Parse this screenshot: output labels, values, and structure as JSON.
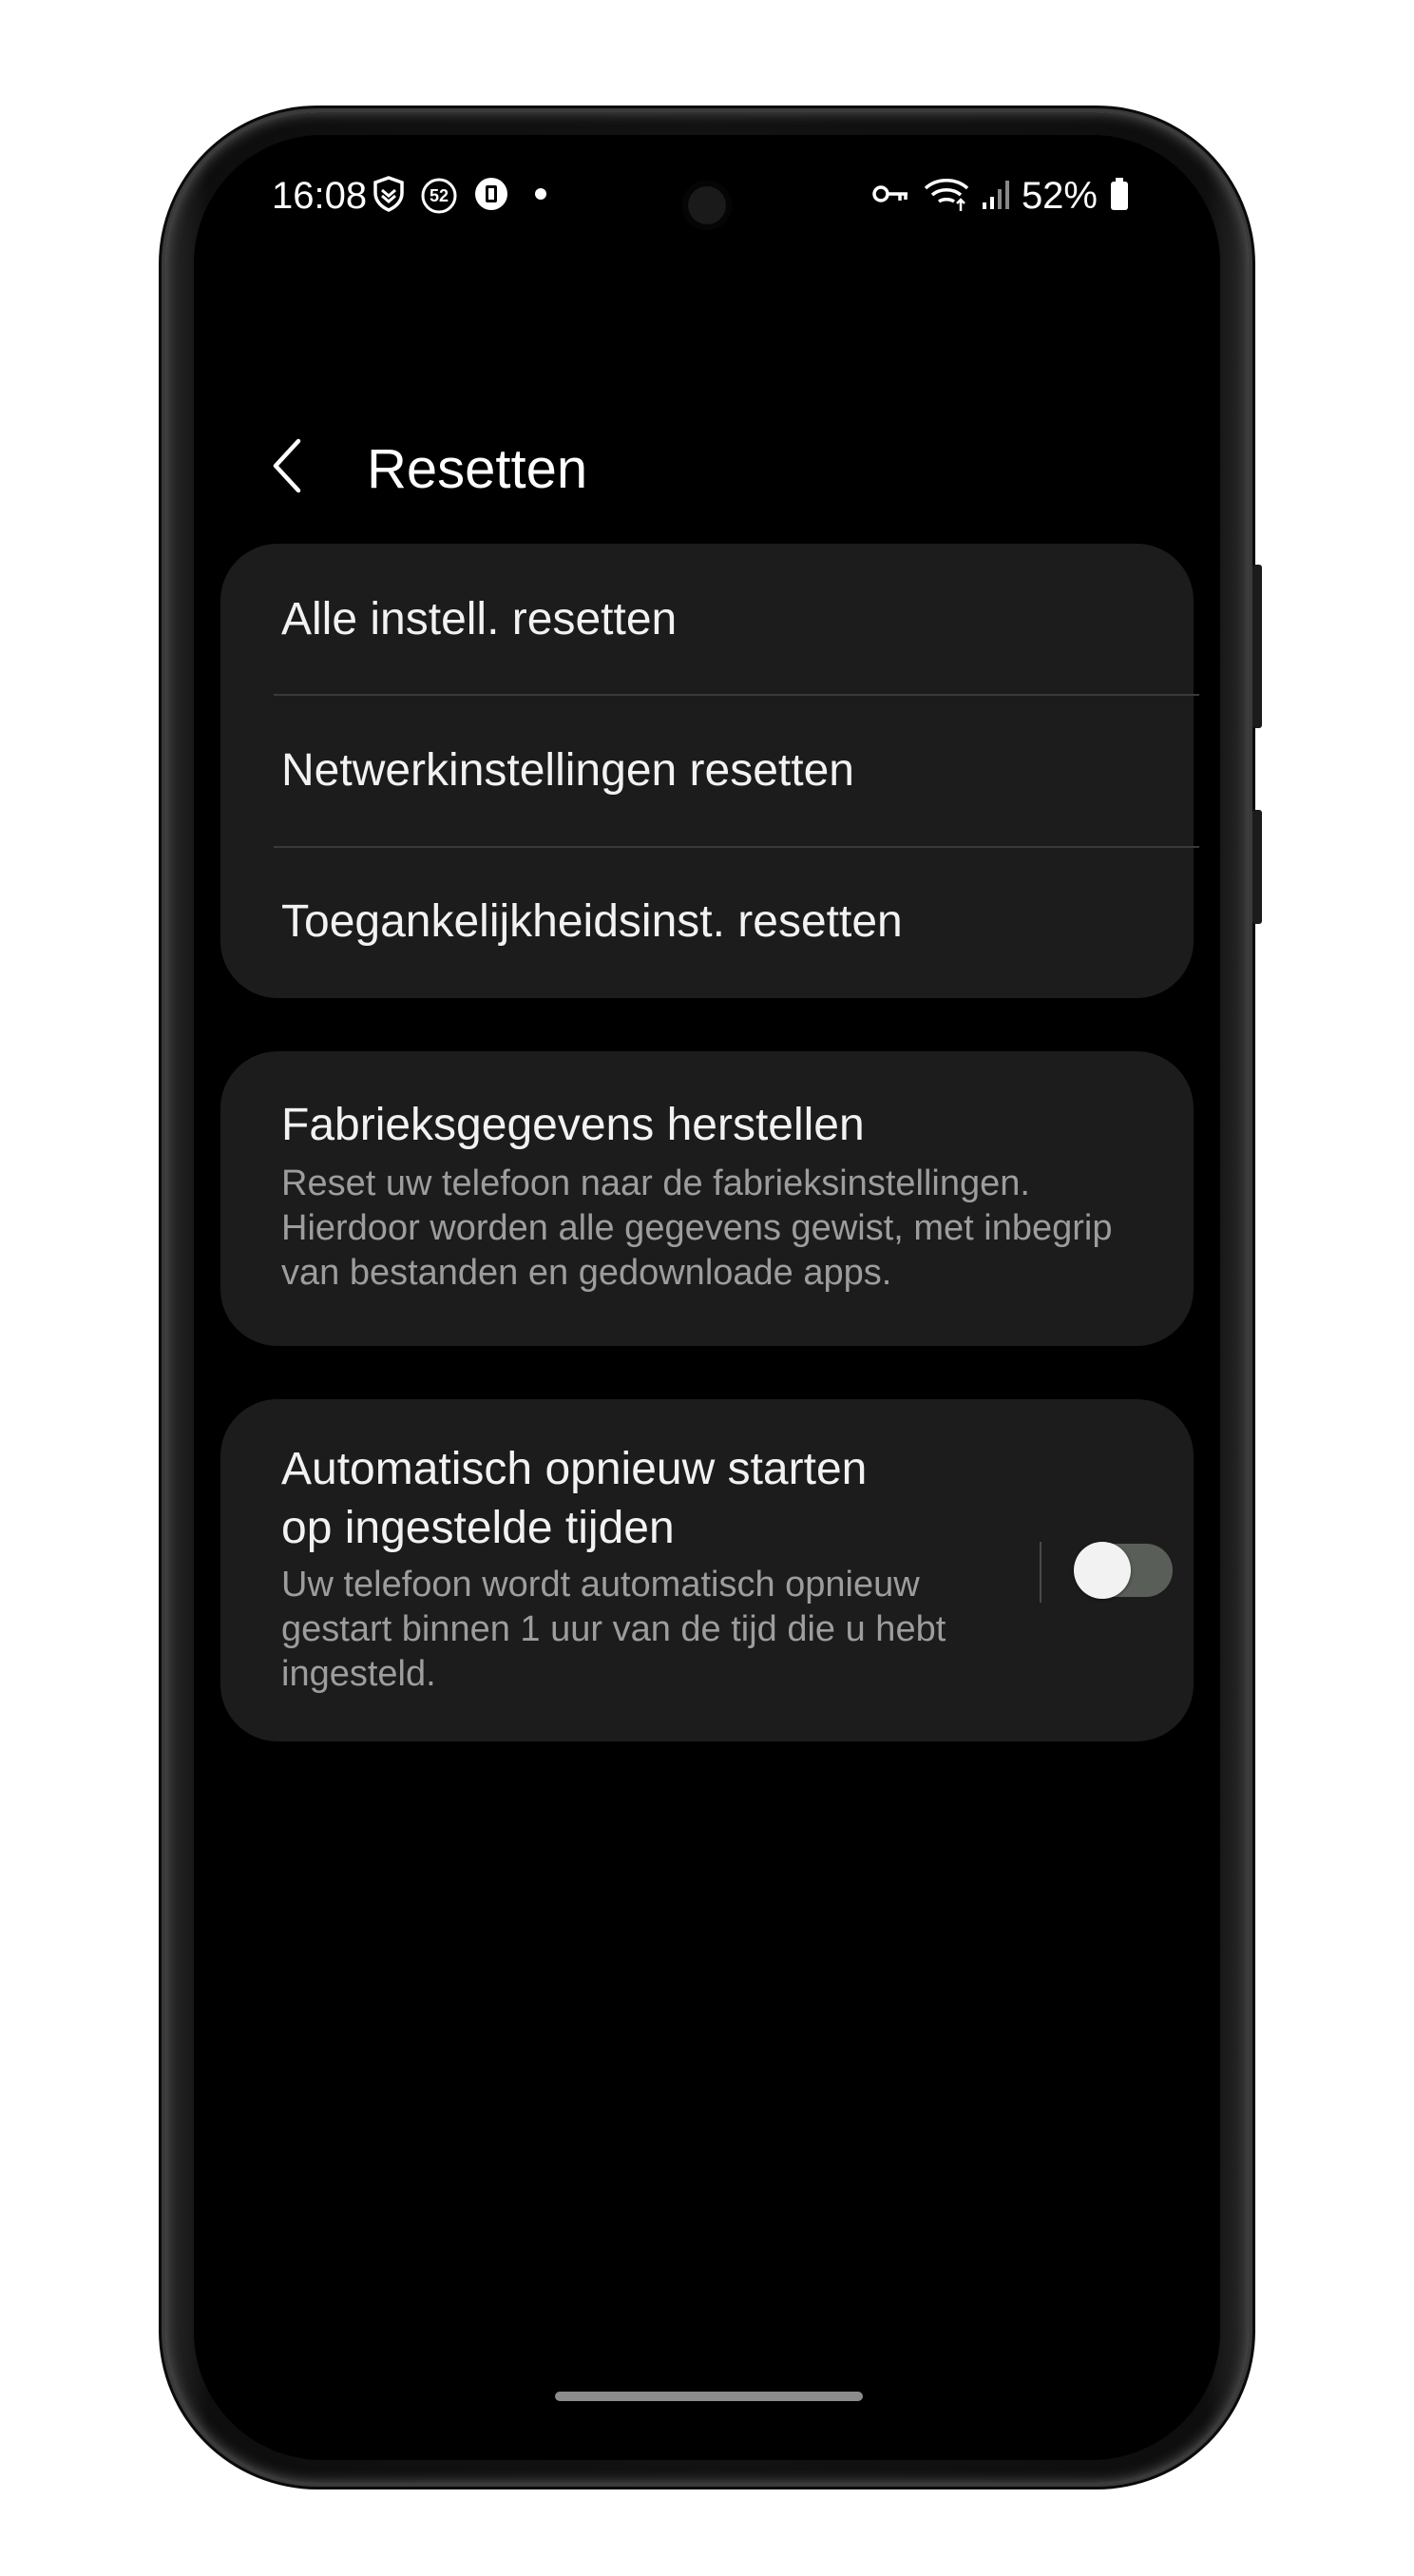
{
  "status_bar": {
    "time": "16:08",
    "notification_badge": "52",
    "battery_percent": "52%",
    "icons_left": [
      "shield-icon",
      "notification-count-icon",
      "app-notification-icon",
      "dot-icon"
    ],
    "icons_right": [
      "vpn-key-icon",
      "wifi-icon",
      "signal-icon",
      "battery-icon"
    ]
  },
  "header": {
    "title": "Resetten",
    "back_icon": "chevron-left-icon"
  },
  "reset_options": [
    {
      "label": "Alle instell. resetten"
    },
    {
      "label": "Netwerkinstellingen resetten"
    },
    {
      "label": "Toegankelijkheidsinst. resetten"
    }
  ],
  "factory_reset": {
    "title": "Fabrieksgegevens herstellen",
    "line1": "Reset uw telefoon naar de fabrieksinstellingen.",
    "line2": "Hierdoor worden alle gegevens gewist, met inbegrip",
    "line3": "van bestanden en gedownloade apps."
  },
  "auto_restart": {
    "title_line1": "Automatisch opnieuw starten",
    "title_line2": "op ingestelde tijden",
    "desc_line1": "Uw telefoon wordt automatisch opnieuw",
    "desc_line2": "gestart binnen 1 uur van de tijd die u hebt",
    "desc_line3": "ingesteld.",
    "enabled": false
  },
  "colors": {
    "background": "#000000",
    "card": "#1c1c1c",
    "text_primary": "#f2f2f2",
    "text_secondary": "#9d9d9d",
    "toggle_track_off": "#5a5e58"
  }
}
